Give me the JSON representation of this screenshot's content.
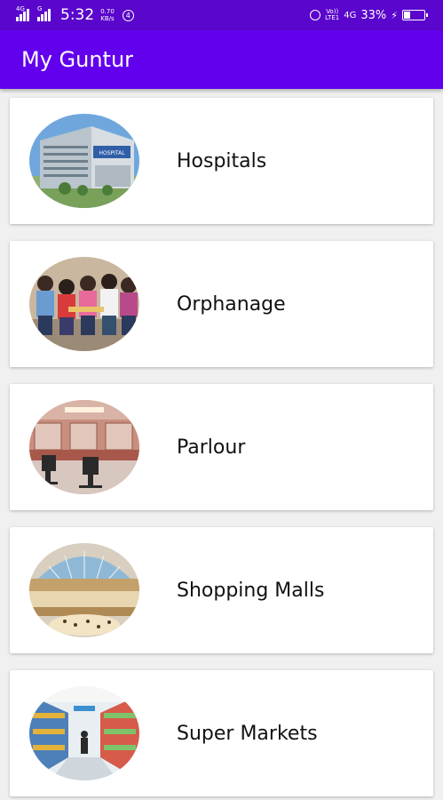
{
  "status_bar": {
    "signal1_label": "4G",
    "signal2_label": "G",
    "time": "5:32",
    "net_speed_value": "0.70",
    "net_speed_unit": "KB/s",
    "notification_count": "4",
    "volte_line1": "Vo))",
    "volte_line2": "LTE1",
    "network_type": "4G",
    "battery_percent": "33%",
    "battery_level": 0.33
  },
  "app_bar": {
    "title": "My Guntur"
  },
  "categories": [
    {
      "label": "Hospitals",
      "image": "hospital-building-photo",
      "sign_text": "HOSPITAL"
    },
    {
      "label": "Orphanage",
      "image": "children-group-photo"
    },
    {
      "label": "Parlour",
      "image": "beauty-salon-photo"
    },
    {
      "label": "Shopping Malls",
      "image": "mall-atrium-photo"
    },
    {
      "label": "Super Markets",
      "image": "supermarket-aisle-photo"
    }
  ]
}
